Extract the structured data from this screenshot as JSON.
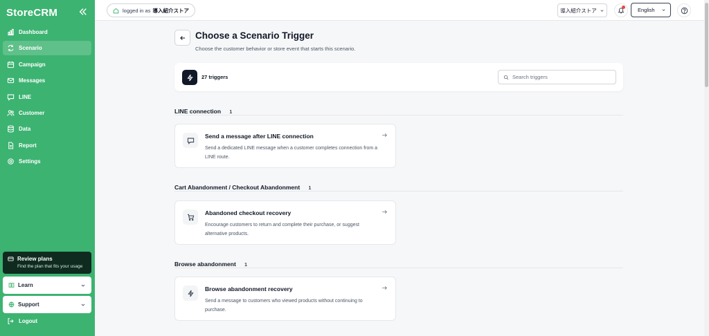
{
  "sidebar": {
    "brand": "StoreCRM",
    "items": [
      {
        "label": "Dashboard",
        "icon": "chart-icon"
      },
      {
        "label": "Scenario",
        "icon": "refresh-icon"
      },
      {
        "label": "Campaign",
        "icon": "calendar-icon"
      },
      {
        "label": "Messages",
        "icon": "mail-icon"
      },
      {
        "label": "LINE",
        "icon": "chat-icon"
      },
      {
        "label": "Customer",
        "icon": "users-icon"
      },
      {
        "label": "Data",
        "icon": "database-icon"
      },
      {
        "label": "Report",
        "icon": "document-icon"
      },
      {
        "label": "Settings",
        "icon": "gear-icon"
      }
    ],
    "active": "Scenario",
    "review": {
      "title": "Review plans",
      "subtitle": "Find the plan that fits your usage"
    },
    "learn_label": "Learn",
    "support_label": "Support",
    "logout_label": "Logout"
  },
  "topbar": {
    "login_prefix": "logged in as",
    "login_store": "導入紹介ストア",
    "store_select": "導入紹介ストア",
    "language": "English"
  },
  "page": {
    "title": "Choose a Scenario Trigger",
    "subtitle": "Choose the customer behavior or store event that starts this scenario.",
    "trigger_count": "27 triggers",
    "search_placeholder": "Search triggers"
  },
  "sections": [
    {
      "title": "LINE connection",
      "count": "1",
      "card": {
        "title": "Send a message after LINE connection",
        "description": "Send a dedicated LINE message when a customer completes connection from a LINE route.",
        "icon": "chat-icon"
      }
    },
    {
      "title": "Cart Abandonment / Checkout Abandonment",
      "count": "1",
      "card": {
        "title": "Abandoned checkout recovery",
        "description": "Encourage customers to return and complete their purchase, or suggest alternative products.",
        "icon": "cart-icon"
      }
    },
    {
      "title": "Browse abandonment",
      "count": "1",
      "card": {
        "title": "Browse abandonment recovery",
        "description": "Send a message to customers who viewed products without continuing to purchase.",
        "icon": "bolt-icon"
      }
    }
  ],
  "colors": {
    "sidebar": "#3cb371",
    "review_bg": "#0f2b1f",
    "page_bg": "#f6f7f8",
    "notification_dot": "#ef4444"
  }
}
